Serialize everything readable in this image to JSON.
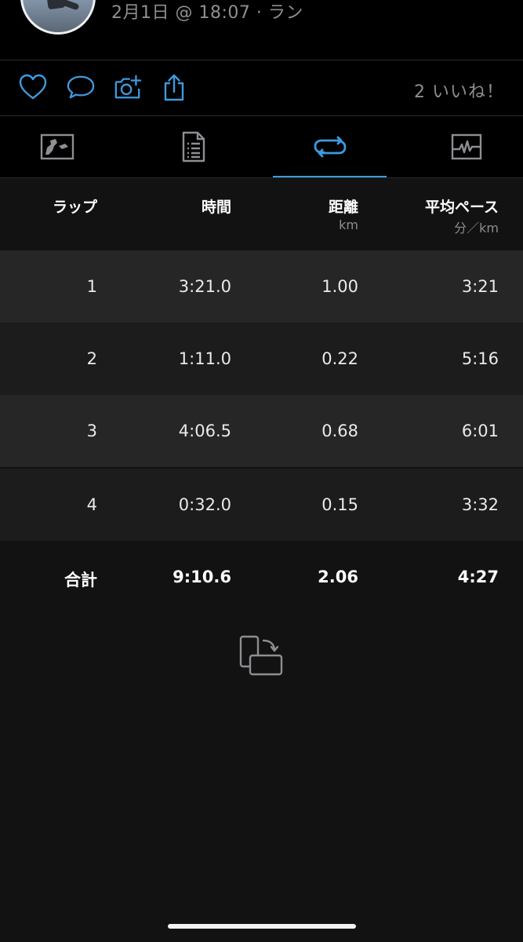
{
  "activity": {
    "meta": "2月1日 @ 18:07 · ラン"
  },
  "actions": {
    "likes_label": "2 いいね！"
  },
  "tabs": [
    {
      "icon": "map-icon"
    },
    {
      "icon": "stats-document-icon"
    },
    {
      "icon": "laps-loop-icon",
      "selected": true
    },
    {
      "icon": "chart-pulse-icon"
    }
  ],
  "table": {
    "headers": [
      {
        "label": "ラップ",
        "unit": ""
      },
      {
        "label": "時間",
        "unit": ""
      },
      {
        "label": "距離",
        "unit": "km"
      },
      {
        "label": "平均ペース",
        "unit": "分／km"
      }
    ],
    "rows": [
      {
        "lap": "1",
        "time": "3:21.0",
        "distance": "1.00",
        "pace": "3:21"
      },
      {
        "lap": "2",
        "time": "1:11.0",
        "distance": "0.22",
        "pace": "5:16"
      },
      {
        "lap": "3",
        "time": "4:06.5",
        "distance": "0.68",
        "pace": "6:01"
      },
      {
        "lap": "4",
        "time": "0:32.0",
        "distance": "0.15",
        "pace": "3:32"
      }
    ],
    "total": {
      "label": "合計",
      "time": "9:10.6",
      "distance": "2.06",
      "pace": "4:27"
    }
  },
  "colors": {
    "accent": "#3d9be0",
    "background": "#121212",
    "row_alt": "#262626"
  }
}
